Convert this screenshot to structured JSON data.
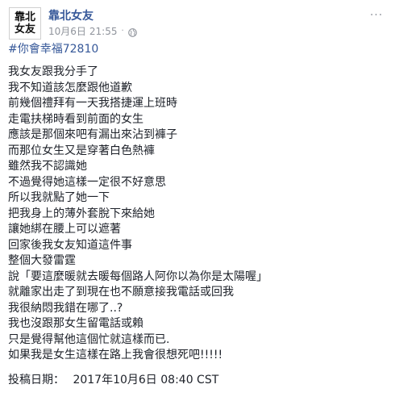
{
  "page": {
    "avatar_lines": [
      "靠北",
      "女友"
    ],
    "name": "靠北女友",
    "date": "10月6日",
    "time": "21:55",
    "separator": "·",
    "more_label": "···",
    "audience_icon": "globe-icon",
    "more_icon": "ellipsis-icon"
  },
  "post": {
    "hashtag": "#你會幸福72810",
    "lines": [
      "我女友跟我分手了",
      "我不知道該怎麼跟他道歉",
      "前幾個禮拜有一天我搭捷運上班時",
      "走電扶梯時看到前面的女生",
      "應該是那個來吧有漏出來沾到褲子",
      "而那位女生又是穿著白色熱褲",
      "雖然我不認識她",
      "不過覺得她這樣一定很不好意思",
      "所以我就點了她一下",
      "把我身上的薄外套脫下來給她",
      "讓她綁在腰上可以遮著",
      "回家後我女友知道這件事",
      "整個大發雷霆",
      "說「要這麼暖就去暖每個路人阿你以為你是太陽喔」",
      "就離家出走了到現在也不願意接我電話或回我",
      "我很納悶我錯在哪了..?",
      "我也沒跟那女生留電話或賴",
      "只是覺得幫他這個忙就這樣而已.",
      "如果我是女生這樣在路上我會很想死吧!!!!!"
    ],
    "posted_label": "投稿日期：",
    "posted_value": "2017年10月6日 08:40 CST"
  },
  "colors": {
    "link": "#365899",
    "meta": "#90949c",
    "text": "#1d2129"
  }
}
